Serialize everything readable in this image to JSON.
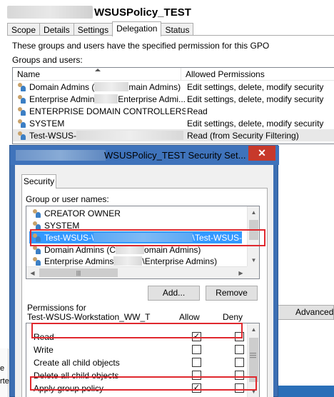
{
  "gpo": {
    "title": "WSUSPolicy_TEST",
    "tabs": [
      "Scope",
      "Details",
      "Settings",
      "Delegation",
      "Status"
    ],
    "active_tab": "Delegation",
    "description": "These groups and users have the specified permission for this GPO",
    "groups_label": "Groups and users:",
    "columns": {
      "name": "Name",
      "permissions": "Allowed Permissions"
    },
    "rows": [
      {
        "name_prefix": "Domain Admins (",
        "name_suffix": "main Admins)",
        "permission": "Edit settings, delete, modify security"
      },
      {
        "name_prefix": "Enterprise Admin",
        "name_suffix": "Enterprise Admi...",
        "permission": "Edit settings, delete, modify security"
      },
      {
        "name_prefix": "ENTERPRISE DOMAIN CONTROLLERS",
        "name_suffix": "",
        "permission": "Read"
      },
      {
        "name_prefix": "SYSTEM",
        "name_suffix": "",
        "permission": "Edit settings, delete, modify security"
      },
      {
        "name_prefix": "Test-WSUS-",
        "name_suffix": "",
        "permission": "Read (from Security Filtering)"
      }
    ],
    "advanced_button": "Advanced...",
    "left_edge_text": [
      "e",
      "rte"
    ]
  },
  "dialog": {
    "title": "WSUSPolicy_TEST Security Set...",
    "close_glyph": "✕",
    "tab": "Security",
    "group_label": "Group or user names:",
    "users": [
      {
        "prefix": "CREATOR OWNER",
        "suffix": ""
      },
      {
        "prefix": "SYSTEM",
        "suffix": ""
      },
      {
        "prefix": "Test-WSUS-\\",
        "suffix": "\\Test-WSUS-"
      },
      {
        "prefix": "Domain Admins (C",
        "suffix": "omain Admins)"
      },
      {
        "prefix": "Enterprise Admins",
        "suffix": "\\Enterprise Admins)"
      }
    ],
    "add_button": "Add...",
    "remove_button": "Remove",
    "permissions_for_label": "Permissions for",
    "permissions_for_name": "Test-WSUS-Workstation_WW_T",
    "allow_label": "Allow",
    "deny_label": "Deny",
    "permissions": [
      {
        "name": "Read",
        "allow": true,
        "deny": false
      },
      {
        "name": "Write",
        "allow": false,
        "deny": false
      },
      {
        "name": "Create all child objects",
        "allow": false,
        "deny": false
      },
      {
        "name": "Delete all child objects",
        "allow": false,
        "deny": false
      },
      {
        "name": "Apply group policy",
        "allow": true,
        "deny": false
      }
    ],
    "check_glyph": "✓"
  },
  "colors": {
    "title_bar": "#3f73bb",
    "close": "#c7392b",
    "selection": "#3399ff",
    "highlight": "#e0282e"
  }
}
